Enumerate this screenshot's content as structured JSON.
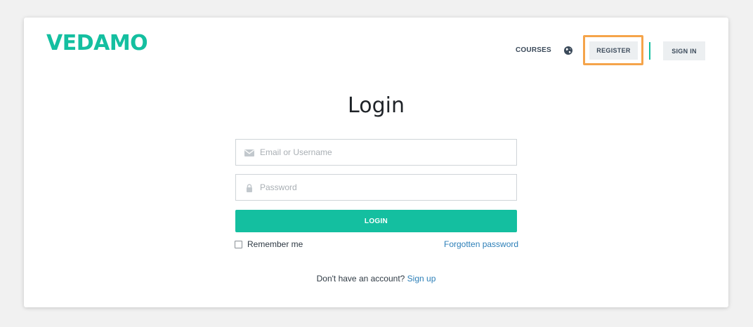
{
  "header": {
    "logo_text": "VEDAMO",
    "nav": {
      "courses_label": "COURSES",
      "globe_icon": "globe-icon",
      "register_label": "REGISTER",
      "signin_label": "SIGN IN"
    }
  },
  "login": {
    "title": "Login",
    "email_placeholder": "Email or Username",
    "password_placeholder": "Password",
    "submit_label": "LOGIN",
    "remember_label": "Remember me",
    "remember_checked": false,
    "forgot_label": "Forgotten password",
    "no_account_text": "Don't have an account?",
    "signup_label": "Sign up"
  },
  "colors": {
    "brand": "#14bfa0",
    "link": "#2c7fb8",
    "highlight": "#f5a44a"
  }
}
